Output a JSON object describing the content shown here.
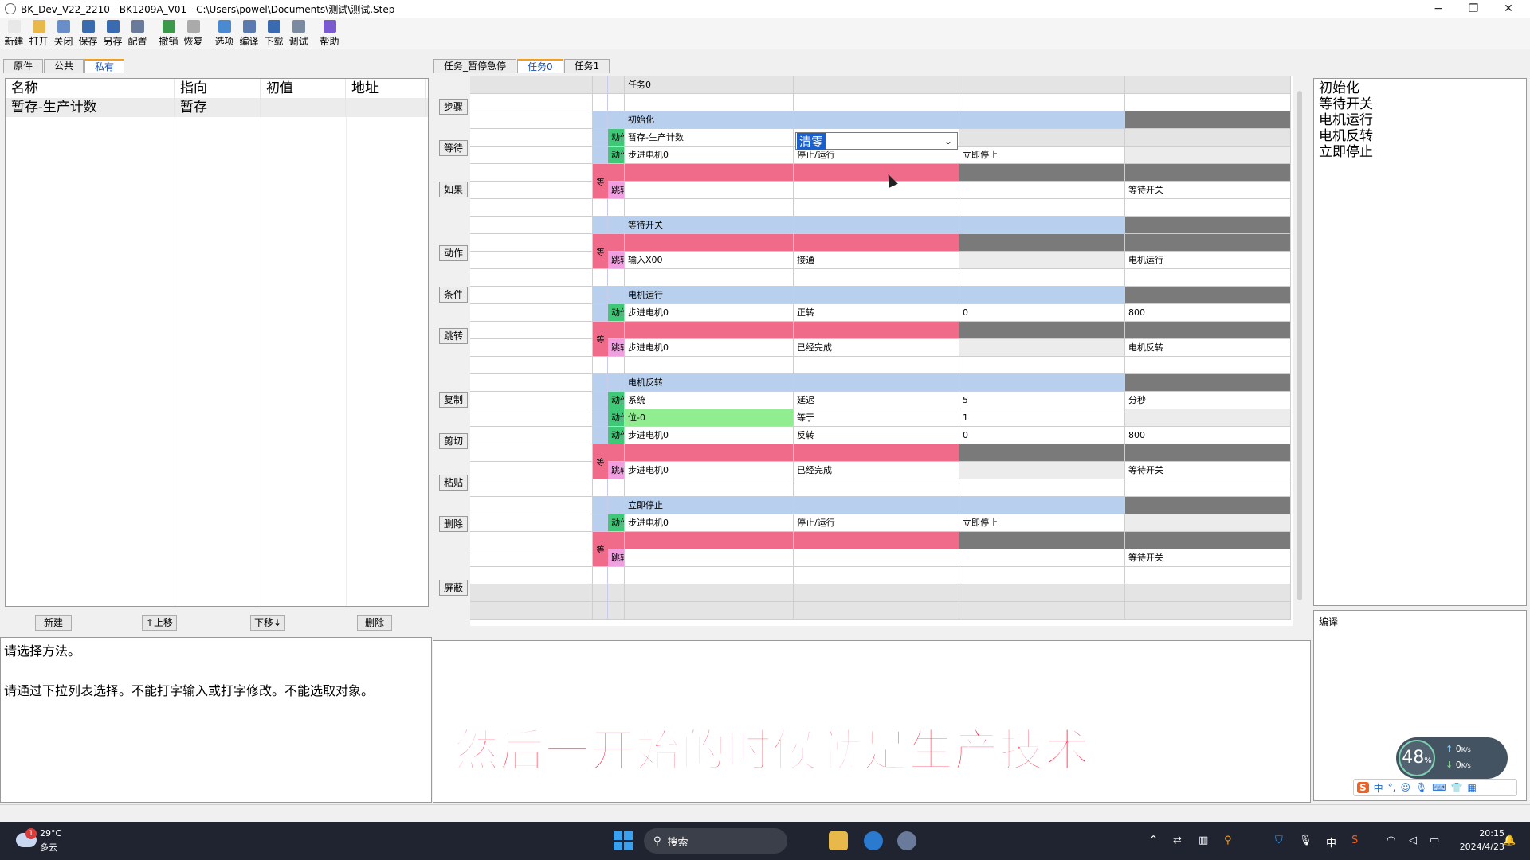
{
  "window": {
    "title": "BK_Dev_V22_2210  - BK1209A_V01 -  C:\\Users\\powel\\Documents\\测试\\测试.Step",
    "min": "−",
    "max": "❐",
    "close": "✕"
  },
  "toolbar": [
    {
      "label": "新建",
      "icon": "new-file-icon",
      "color": "#e8e8e8"
    },
    {
      "label": "打开",
      "icon": "open-folder-icon",
      "color": "#e8b84a"
    },
    {
      "label": "关闭",
      "icon": "close-doc-icon",
      "color": "#6a8fc8"
    },
    {
      "label": "保存",
      "icon": "save-disk-icon",
      "color": "#3a6ab0"
    },
    {
      "label": "另存",
      "icon": "save-as-icon",
      "color": "#3a6ab0"
    },
    {
      "label": "配置",
      "icon": "config-wrench-icon",
      "color": "#6a7a9a"
    },
    {
      "label": "撤销",
      "icon": "undo-icon",
      "color": "#3a9a4a"
    },
    {
      "label": "恢复",
      "icon": "redo-icon",
      "color": "#aaaaaa"
    },
    {
      "label": "选项",
      "icon": "options-icon",
      "color": "#4a8ad0"
    },
    {
      "label": "编译",
      "icon": "compile-icon",
      "color": "#5a7ab0"
    },
    {
      "label": "下载",
      "icon": "download-icon",
      "color": "#3a6ab0"
    },
    {
      "label": "调试",
      "icon": "debug-gear-icon",
      "color": "#7a8aa0"
    },
    {
      "label": "帮助",
      "icon": "help-icon",
      "color": "#7a5ad0"
    }
  ],
  "left_tabs": [
    "原件",
    "公共",
    "私有"
  ],
  "var_table": {
    "headers": [
      "名称",
      "指向",
      "初值",
      "地址"
    ],
    "rows": [
      [
        "暂存-生产计数",
        "暂存",
        "",
        ""
      ]
    ]
  },
  "var_buttons": {
    "new": "新建",
    "up": "↑上移",
    "down": "下移↓",
    "delete": "删除"
  },
  "help_text": {
    "line1": "请选择方法。",
    "line2": "请通过下拉列表选择。不能打字输入或打字修改。不能选取对象。"
  },
  "center_tabs": [
    "任务_暂停急停",
    "任务0",
    "任务1"
  ],
  "side_buttons": [
    "步骤",
    "等待",
    "如果",
    "动作",
    "条件",
    "跳转",
    "复制",
    "剪切",
    "粘贴",
    "删除",
    "屏蔽"
  ],
  "task_title": "任务0",
  "dropdown_value": "清零",
  "steps": [
    {
      "name": "初始化",
      "rows": [
        {
          "tag": "动作",
          "a": "暂存-生产计数",
          "b": "",
          "c": "",
          "d": ""
        },
        {
          "tag": "动作",
          "a": "步进电机0",
          "b": "停止/运行",
          "c": "立即停止",
          "d": ""
        },
        {
          "tag": "跳转",
          "a": "",
          "b": "",
          "c": "",
          "d": "等待开关"
        }
      ]
    },
    {
      "name": "等待开关",
      "rows": [
        {
          "tag": "跳转",
          "a": "输入X00",
          "b": "接通",
          "c": "",
          "d": "电机运行"
        }
      ]
    },
    {
      "name": "电机运行",
      "rows": [
        {
          "tag": "动作",
          "a": "步进电机0",
          "b": "正转",
          "c": "0",
          "d": "800"
        },
        {
          "tag": "跳转",
          "a": "步进电机0",
          "b": "已经完成",
          "c": "",
          "d": "电机反转"
        }
      ]
    },
    {
      "name": "电机反转",
      "rows": [
        {
          "tag": "动作",
          "a": "系统",
          "b": "延迟",
          "c": "5",
          "d": "分秒"
        },
        {
          "tag": "动作",
          "a": "位-0",
          "b": "等于",
          "c": "1",
          "d": ""
        },
        {
          "tag": "动作",
          "a": "步进电机0",
          "b": "反转",
          "c": "0",
          "d": "800"
        },
        {
          "tag": "跳转",
          "a": "步进电机0",
          "b": "已经完成",
          "c": "",
          "d": "等待开关"
        }
      ]
    },
    {
      "name": "立即停止",
      "rows": [
        {
          "tag": "动作",
          "a": "步进电机0",
          "b": "停止/运行",
          "c": "立即停止",
          "d": ""
        },
        {
          "tag": "跳转",
          "a": "",
          "b": "",
          "c": "",
          "d": "等待开关"
        }
      ]
    }
  ],
  "wait_tag": "等",
  "step_list": [
    "初始化",
    "等待开关",
    "电机运行",
    "电机反转",
    "立即停止"
  ],
  "compile_label": "编译",
  "subtitle": "然后一开始的时候就是生产技术",
  "net_widget": {
    "percent": "48",
    "unit": "%",
    "up": "0",
    "down": "0",
    "rate_unit": "K/s"
  },
  "taskbar": {
    "temp": "29°C",
    "weather": "多云",
    "badge": "1",
    "search": "搜索",
    "ime": "中",
    "time": "20:15",
    "date": "2024/4/23"
  },
  "colors": {
    "header_blue": "#b8d0ee",
    "wait_pink": "#f06a8a",
    "action_green": "#3ec878",
    "jump_pink": "#f0a0e0",
    "dark_gray": "#7a7a7a",
    "bit_green": "#90ee90"
  }
}
